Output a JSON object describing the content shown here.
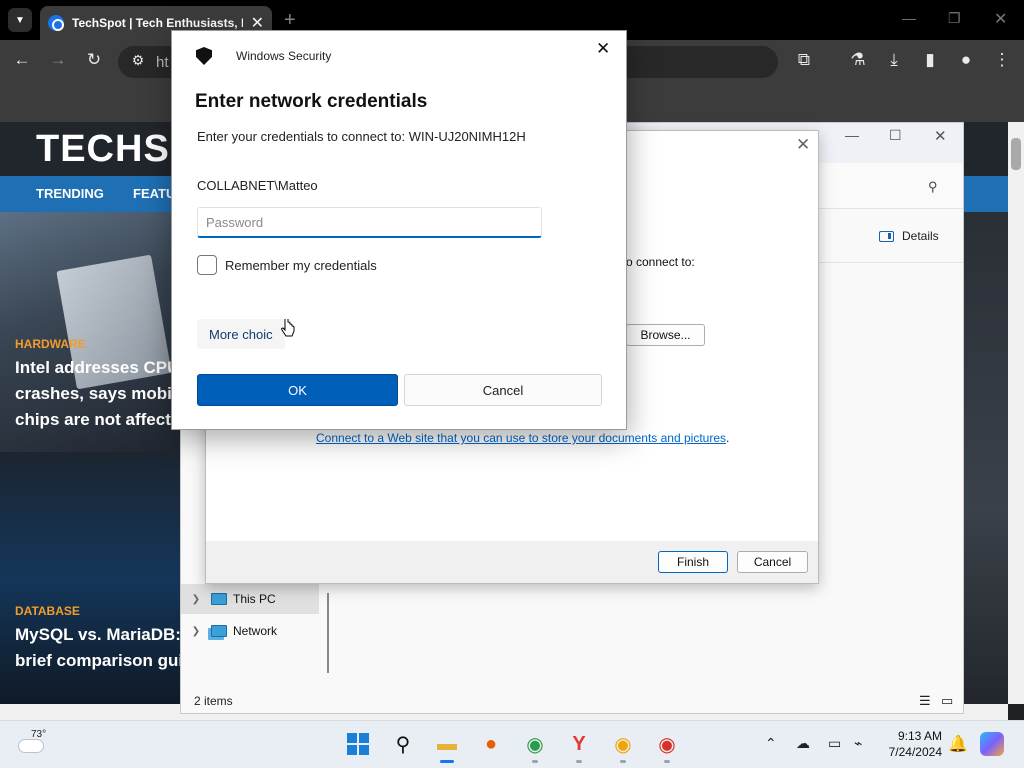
{
  "browser": {
    "tab_title": "TechSpot | Tech Enthusiasts, Po",
    "omnibox_text": "ht"
  },
  "page": {
    "logo": "TECHSP",
    "nav": [
      "TRENDING",
      "FEATU"
    ],
    "articles": [
      {
        "category": "HARDWARE",
        "headline_lines": [
          "Intel addresses CPU",
          "crashes, says mobil",
          "chips are not affecte"
        ]
      },
      {
        "category": "DATABASE",
        "headline_lines": [
          "MySQL vs. MariaDB:",
          "brief comparison gui"
        ]
      }
    ]
  },
  "explorer": {
    "details_label": "Details",
    "tree": [
      {
        "label": "This PC",
        "icon": "pc-icon"
      },
      {
        "label": "Network",
        "icon": "network-icon"
      }
    ],
    "status_items": "2 items"
  },
  "wizard": {
    "partial_label": "o connect to:",
    "browse_label": "Browse...",
    "link_text": "Connect to a Web site that you can use to store your documents and pictures",
    "finish_label": "Finish",
    "cancel_label": "Cancel"
  },
  "security_dialog": {
    "app_name": "Windows Security",
    "heading": "Enter network credentials",
    "subtitle": "Enter your credentials to connect to: WIN-UJ20NIMH12H",
    "username": "COLLABNET\\Matteo",
    "password_placeholder": "Password",
    "password_value": "",
    "remember_label": "Remember my credentials",
    "remember_checked": false,
    "more_choices_label": "More choic",
    "ok_label": "OK",
    "cancel_label": "Cancel"
  },
  "taskbar": {
    "temperature": "73°",
    "time": "9:13 AM",
    "date": "7/24/2024"
  },
  "colors": {
    "accent": "#005fb8",
    "techspot_nav": "#1f6fb5",
    "category": "#f39c2b"
  }
}
